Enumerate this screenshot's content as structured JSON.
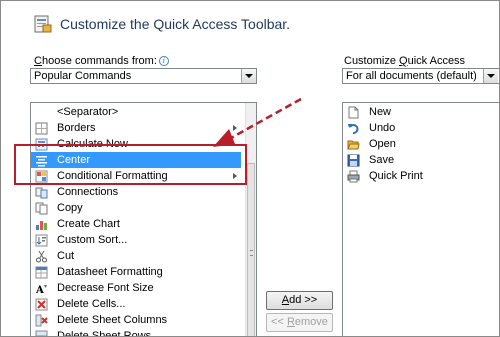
{
  "header": {
    "title": "Customize the Quick Access Toolbar."
  },
  "left": {
    "label_prefix": "C",
    "label_rest": "hoose commands from:",
    "dropdown_value": "Popular Commands",
    "items": [
      {
        "label": "<Separator>",
        "icon": "separator"
      },
      {
        "label": "Borders",
        "icon": "borders-icon"
      },
      {
        "label": "Calculate Now",
        "icon": "calculate-now-icon"
      },
      {
        "label": "Center",
        "icon": "center-align-icon"
      },
      {
        "label": "Conditional Formatting",
        "icon": "conditional-formatting-icon"
      },
      {
        "label": "Connections",
        "icon": "connections-icon"
      },
      {
        "label": "Copy",
        "icon": "copy-icon"
      },
      {
        "label": "Create Chart",
        "icon": "create-chart-icon"
      },
      {
        "label": "Custom Sort...",
        "icon": "custom-sort-icon"
      },
      {
        "label": "Cut",
        "icon": "cut-icon"
      },
      {
        "label": "Datasheet Formatting",
        "icon": "datasheet-formatting-icon"
      },
      {
        "label": "Decrease Font Size",
        "icon": "decrease-font-size-icon"
      },
      {
        "label": "Delete Cells...",
        "icon": "delete-cells-icon"
      },
      {
        "label": "Delete Sheet Columns",
        "icon": "delete-sheet-columns-icon"
      },
      {
        "label": "Delete Sheet Rows",
        "icon": "delete-sheet-rows-icon"
      }
    ]
  },
  "right": {
    "label_pre": "Customize ",
    "label_u": "Q",
    "label_post": "uick Access Toolbar:",
    "dropdown_value": "For all documents (default)",
    "items": [
      {
        "label": "New",
        "icon": "new-document-icon"
      },
      {
        "label": "Undo",
        "icon": "undo-icon"
      },
      {
        "label": "Open",
        "icon": "open-folder-icon"
      },
      {
        "label": "Save",
        "icon": "save-icon"
      },
      {
        "label": "Quick Print",
        "icon": "quick-print-icon"
      }
    ]
  },
  "buttons": {
    "add_u": "A",
    "add_rest": "dd >>",
    "remove_pre": "<< ",
    "remove_u": "R",
    "remove_rest": "emove"
  },
  "colors": {
    "selection": "#3399ff",
    "annotation": "#b81d2a"
  }
}
